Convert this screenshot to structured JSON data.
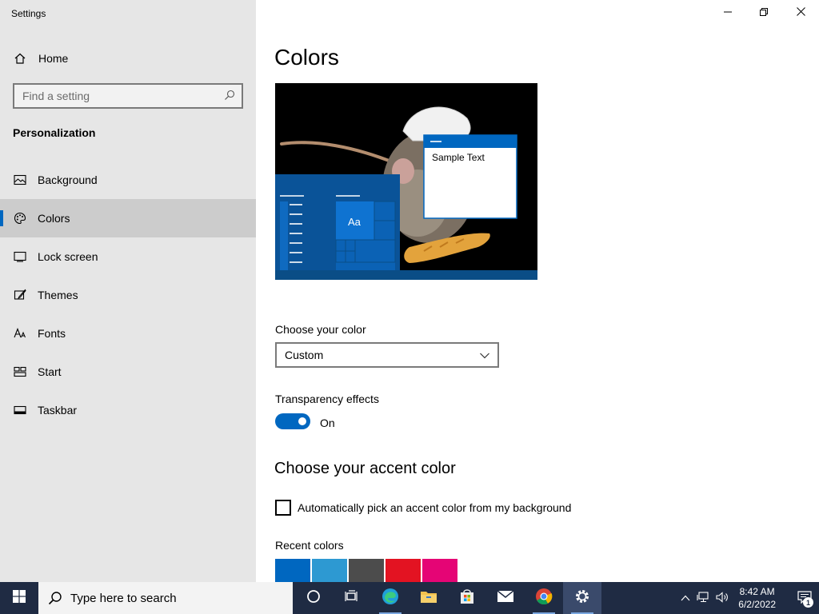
{
  "window": {
    "title": "Settings",
    "controls": [
      "minimize-icon",
      "restore-icon",
      "close-icon"
    ]
  },
  "sidebar": {
    "home_label": "Home",
    "search": {
      "placeholder": "Find a setting",
      "value": ""
    },
    "section_title": "Personalization",
    "items": [
      {
        "label": "Background",
        "icon": "picture-icon",
        "active": false
      },
      {
        "label": "Colors",
        "icon": "palette-icon",
        "active": true
      },
      {
        "label": "Lock screen",
        "icon": "lock-screen-icon",
        "active": false
      },
      {
        "label": "Themes",
        "icon": "brush-icon",
        "active": false
      },
      {
        "label": "Fonts",
        "icon": "font-icon",
        "active": false
      },
      {
        "label": "Start",
        "icon": "start-grid-icon",
        "active": false
      },
      {
        "label": "Taskbar",
        "icon": "taskbar-icon",
        "active": false
      }
    ]
  },
  "main": {
    "title": "Colors",
    "preview": {
      "sample_text": "Sample Text",
      "tile_text": "Aa"
    },
    "choose_color": {
      "label": "Choose your color",
      "value": "Custom"
    },
    "transparency": {
      "label": "Transparency effects",
      "state": "On"
    },
    "accent_heading": "Choose your accent color",
    "auto_accent": {
      "label": "Automatically pick an accent color from my background",
      "checked": false
    },
    "recent_colors": {
      "label": "Recent colors",
      "colors": [
        "#0067c0",
        "#2d99d2",
        "#4c4c4c",
        "#e31322",
        "#e50575"
      ]
    }
  },
  "taskbar": {
    "search_placeholder": "Type here to search",
    "apps": [
      "cortana-icon",
      "task-view-icon",
      "edge-icon",
      "file-explorer-icon",
      "store-icon",
      "mail-icon",
      "chrome-icon",
      "settings-icon"
    ],
    "time": "8:42 AM",
    "date": "6/2/2022",
    "notification_count": "1"
  },
  "colors": {
    "accent": "#0067c0",
    "sidebar_bg": "#e6e6e6",
    "taskbar_bg": "#1f2b43"
  }
}
